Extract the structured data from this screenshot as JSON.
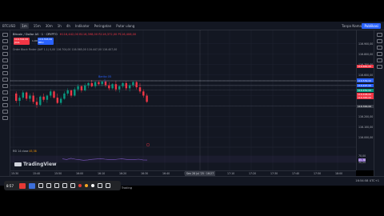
{
  "toolbar": {
    "symbol": "BTCUSD",
    "intervals": [
      "1m",
      "15m",
      "30m",
      "1h",
      "4h"
    ],
    "indicators_label": "Indikator",
    "alert_label": "Peringatan",
    "replay_label": "Putar ulang",
    "name_label": "Tanpa Nama",
    "publish_label": "Publikasi"
  },
  "legend": {
    "title": "Bitcoin / Dollar AS · 1 · CRYPTO",
    "ohlc": "H116,442,00 B116,398,00 R116,372,00 P116,408,00",
    "sell_price": "116.392,00",
    "sell_label": "JUAL",
    "buy_price": "116.393,00",
    "buy_label": "BELI",
    "spread": "1,00",
    "indicator": "Order Block Finder (AVF 1.1) 0,00 116.704,00 116.565,00 116.447,00 116.407,00"
  },
  "annotation": "Berita 05",
  "rsi": {
    "label": "RSI 14 close",
    "value": "45,38"
  },
  "price_axis": {
    "labels": [
      "116.900,00",
      "116.800,00",
      "116.700,00",
      "116.600,00",
      "116.500,00",
      "116.400,00",
      "116.300,00",
      "116.200,00",
      "116.100,00",
      "116.000,00"
    ],
    "tags": [
      {
        "text": "116.681,00",
        "color": "#f23645"
      },
      {
        "text": "116.547,00",
        "color": "#2962ff"
      },
      {
        "text": "116.539,00",
        "color": "#2962ff"
      },
      {
        "text": "116.497,00",
        "color": "#2962ff"
      },
      {
        "text": "116.452,00",
        "color": "#089981"
      },
      {
        "text": "116.408,00",
        "color": "#f23645"
      },
      {
        "text": "116.383,00",
        "color": "#f23645"
      },
      {
        "text": "116.300,00",
        "color": "#363a45"
      }
    ],
    "rsi_labels": [
      "70,00",
      "45,38",
      "30,00"
    ]
  },
  "time_axis": {
    "labels": [
      "15:30",
      "15:40",
      "15:50",
      "16:00",
      "16:10",
      "16:20",
      "16:30",
      "16:40",
      "16:50",
      "17:00",
      "17:10",
      "17:20",
      "17:30",
      "17:40",
      "17:50",
      "18:00"
    ],
    "crosshair": "Sen 28 Jul '25 · 16:27"
  },
  "bottom_bar": {
    "panel_label": "Trading",
    "panel2_label": "Panel Trading",
    "clock": "16:54:58 UTC+1",
    "overlay_time": "8:57"
  },
  "brand": "TradingView",
  "colors": {
    "up": "#089981",
    "down": "#f23645",
    "bg": "#131722",
    "accent": "#2962ff"
  },
  "candles": [
    {
      "o": 116420,
      "h": 116440,
      "l": 116330,
      "c": 116350
    },
    {
      "o": 116350,
      "h": 116400,
      "l": 116300,
      "c": 116380
    },
    {
      "o": 116380,
      "h": 116450,
      "l": 116360,
      "c": 116430
    },
    {
      "o": 116430,
      "h": 116440,
      "l": 116350,
      "c": 116370
    },
    {
      "o": 116370,
      "h": 116420,
      "l": 116340,
      "c": 116400
    },
    {
      "o": 116400,
      "h": 116430,
      "l": 116320,
      "c": 116340
    },
    {
      "o": 116340,
      "h": 116380,
      "l": 116280,
      "c": 116310
    },
    {
      "o": 116310,
      "h": 116400,
      "l": 116300,
      "c": 116390
    },
    {
      "o": 116390,
      "h": 116420,
      "l": 116340,
      "c": 116360
    },
    {
      "o": 116360,
      "h": 116410,
      "l": 116330,
      "c": 116400
    },
    {
      "o": 116400,
      "h": 116460,
      "l": 116380,
      "c": 116440
    },
    {
      "o": 116440,
      "h": 116450,
      "l": 116370,
      "c": 116380
    },
    {
      "o": 116380,
      "h": 116420,
      "l": 116320,
      "c": 116330
    },
    {
      "o": 116330,
      "h": 116390,
      "l": 116310,
      "c": 116370
    },
    {
      "o": 116370,
      "h": 116440,
      "l": 116360,
      "c": 116420
    },
    {
      "o": 116420,
      "h": 116470,
      "l": 116400,
      "c": 116450
    },
    {
      "o": 116450,
      "h": 116460,
      "l": 116380,
      "c": 116400
    },
    {
      "o": 116400,
      "h": 116480,
      "l": 116390,
      "c": 116460
    },
    {
      "o": 116460,
      "h": 116510,
      "l": 116440,
      "c": 116490
    },
    {
      "o": 116490,
      "h": 116500,
      "l": 116430,
      "c": 116450
    },
    {
      "o": 116450,
      "h": 116520,
      "l": 116440,
      "c": 116500
    },
    {
      "o": 116500,
      "h": 116530,
      "l": 116470,
      "c": 116520
    },
    {
      "o": 116520,
      "h": 116550,
      "l": 116480,
      "c": 116490
    },
    {
      "o": 116490,
      "h": 116540,
      "l": 116470,
      "c": 116530
    },
    {
      "o": 116530,
      "h": 116545,
      "l": 116500,
      "c": 116510
    },
    {
      "o": 116510,
      "h": 116540,
      "l": 116490,
      "c": 116535
    },
    {
      "o": 116535,
      "h": 116545,
      "l": 116480,
      "c": 116500
    },
    {
      "o": 116500,
      "h": 116530,
      "l": 116450,
      "c": 116470
    },
    {
      "o": 116470,
      "h": 116520,
      "l": 116460,
      "c": 116510
    },
    {
      "o": 116510,
      "h": 116540,
      "l": 116440,
      "c": 116460
    },
    {
      "o": 116460,
      "h": 116500,
      "l": 116430,
      "c": 116490
    },
    {
      "o": 116490,
      "h": 116530,
      "l": 116470,
      "c": 116520
    },
    {
      "o": 116520,
      "h": 116540,
      "l": 116450,
      "c": 116470
    },
    {
      "o": 116470,
      "h": 116520,
      "l": 116440,
      "c": 116500
    },
    {
      "o": 116500,
      "h": 116545,
      "l": 116480,
      "c": 116530
    },
    {
      "o": 116530,
      "h": 116540,
      "l": 116460,
      "c": 116480
    },
    {
      "o": 116480,
      "h": 116520,
      "l": 116420,
      "c": 116440
    },
    {
      "o": 116440,
      "h": 116460,
      "l": 116380,
      "c": 116400
    },
    {
      "o": 116400,
      "h": 116420,
      "l": 116330,
      "c": 116340
    }
  ],
  "rsi_values": [
    52,
    48,
    55,
    50,
    47,
    44,
    46,
    49,
    51,
    53,
    50,
    48,
    47,
    50,
    52,
    49,
    47,
    48,
    50,
    46,
    45
  ]
}
